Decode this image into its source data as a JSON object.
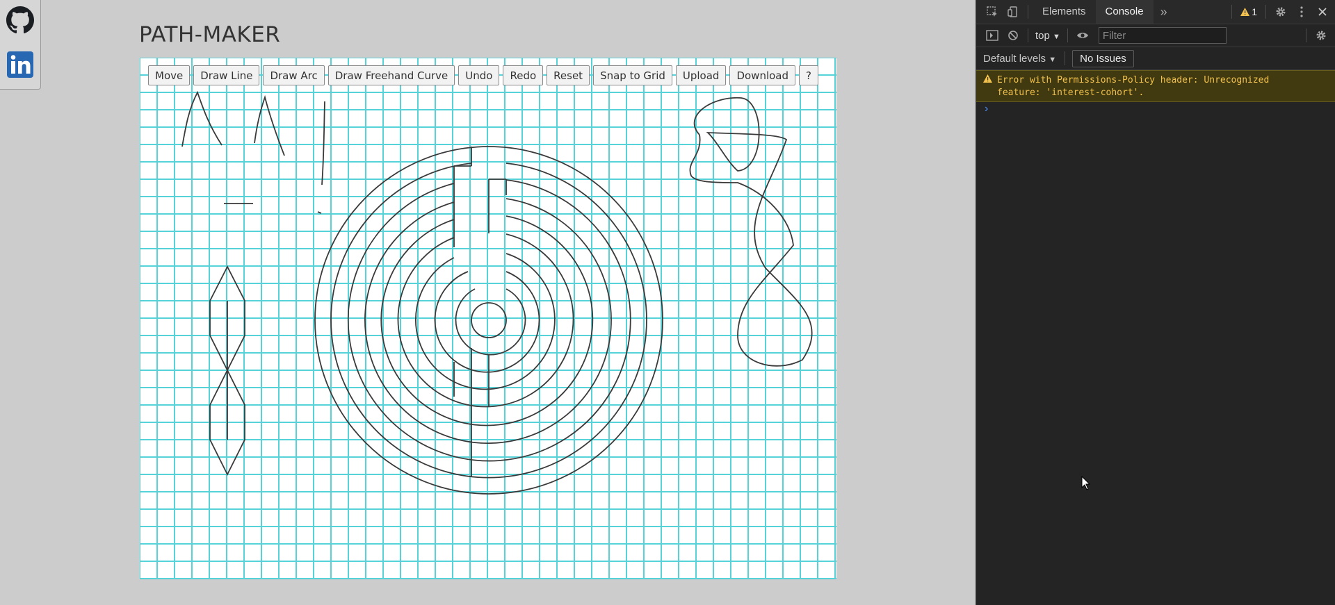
{
  "app": {
    "title": "PATH-MAKER",
    "toolbar": [
      "Move",
      "Draw Line",
      "Draw Arc",
      "Draw Freehand Curve",
      "Undo",
      "Redo",
      "Reset",
      "Snap to Grid",
      "Upload",
      "Download",
      "?"
    ],
    "social": [
      "github-icon",
      "linkedin-icon"
    ],
    "colors": {
      "page_bg": "#cccccc",
      "grid_line": "#55d3d8",
      "ink": "#3a3a3a"
    }
  },
  "devtools": {
    "tabs": [
      "Elements",
      "Console"
    ],
    "active_tab": "Console",
    "warning_count": "1",
    "context": "top",
    "filter_placeholder": "Filter",
    "levels": "Default levels",
    "issues": "No Issues",
    "message": "Error with Permissions-Policy header: Unrecognized\nfeature: 'interest-cohort'."
  }
}
